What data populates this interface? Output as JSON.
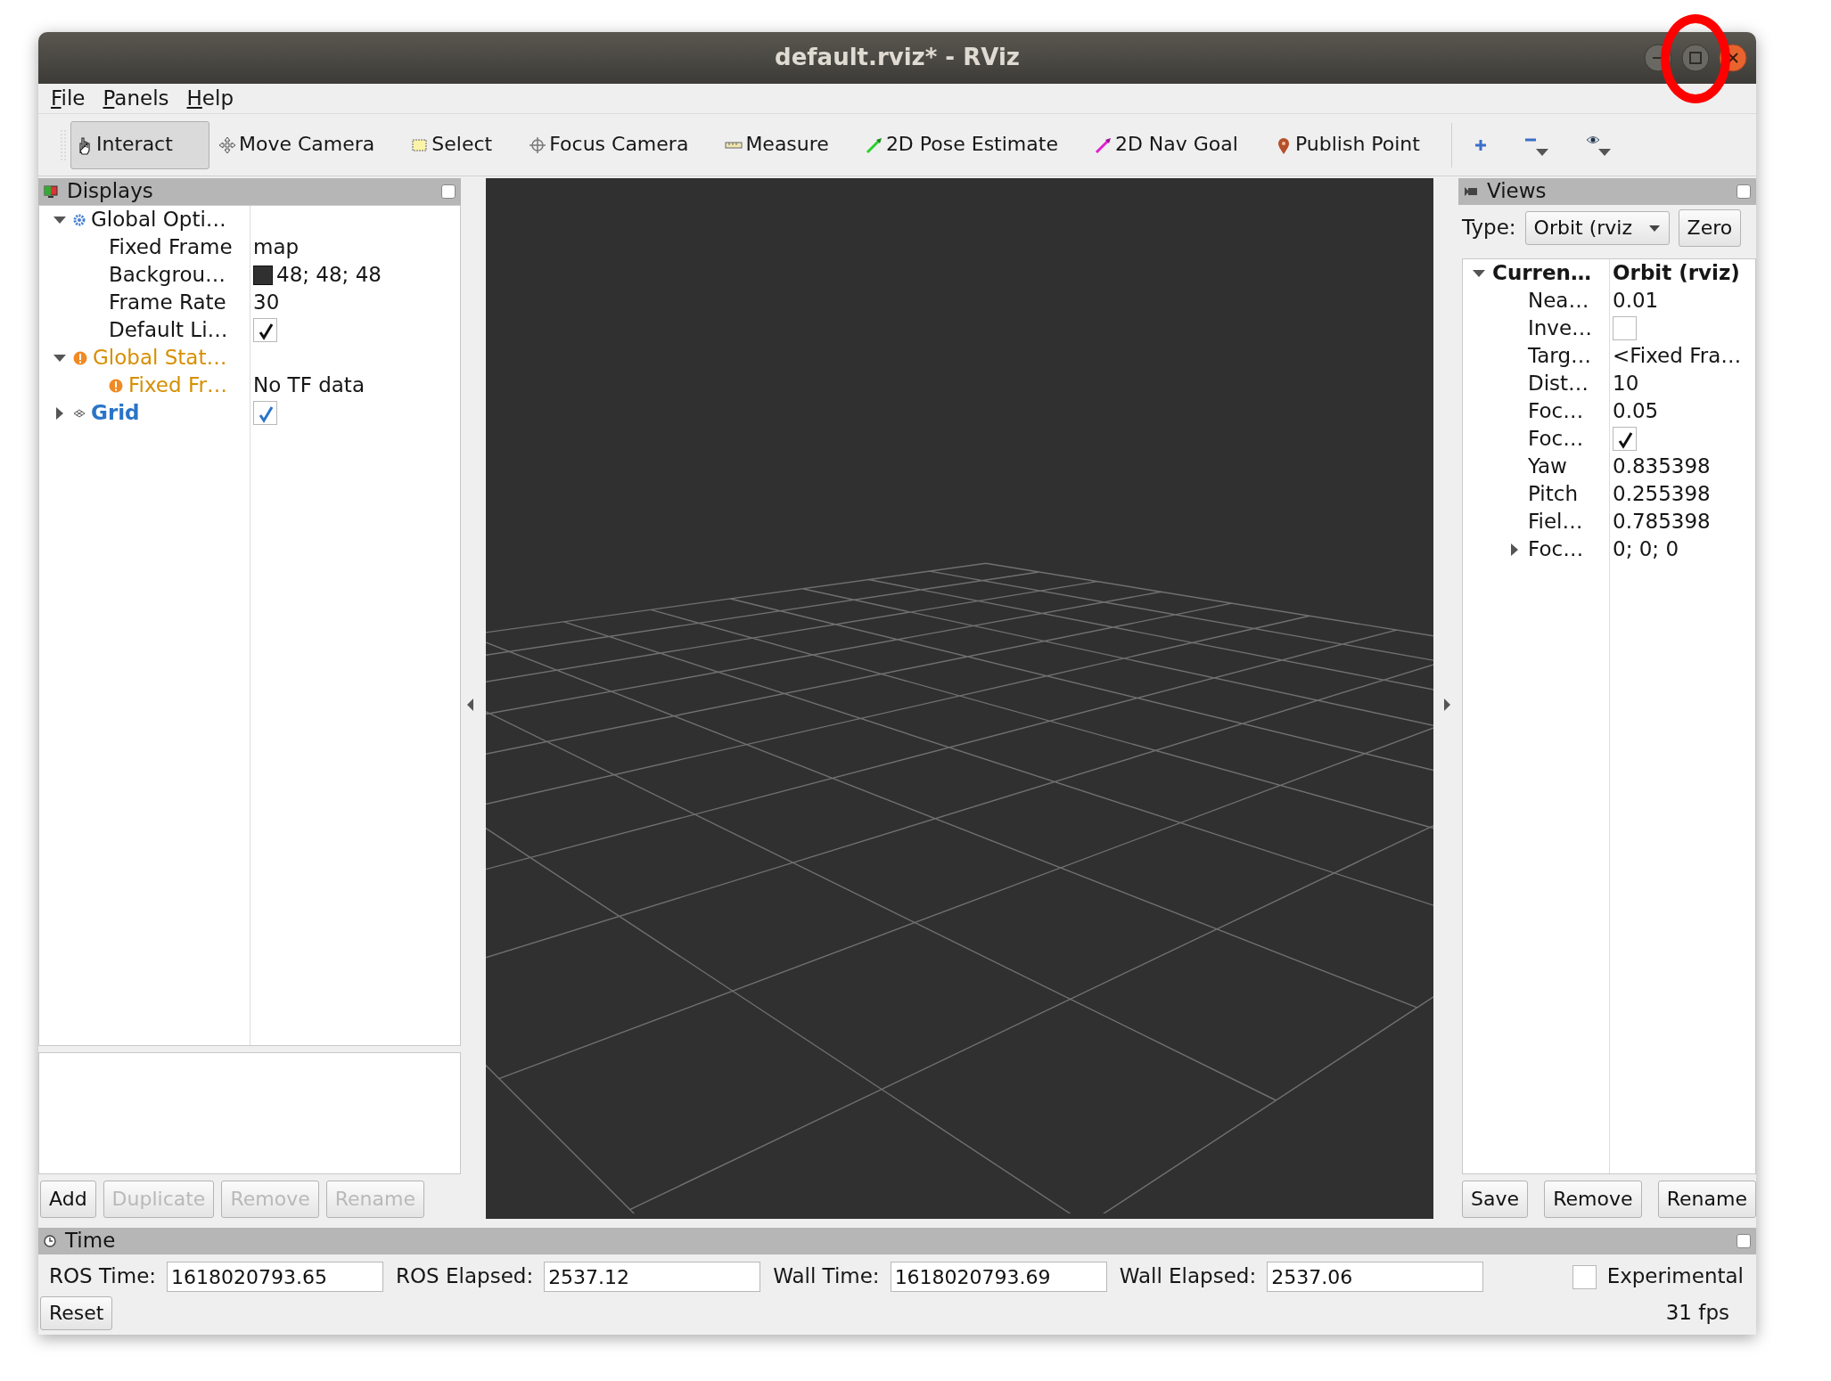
{
  "window": {
    "title": "default.rviz* - RViz"
  },
  "menu": [
    {
      "label": "File"
    },
    {
      "label": "Panels"
    },
    {
      "label": "Help"
    }
  ],
  "toolbar": {
    "tools": [
      {
        "label": "Interact",
        "selected": true
      },
      {
        "label": "Move Camera",
        "selected": false
      },
      {
        "label": "Select",
        "selected": false
      },
      {
        "label": "Focus Camera",
        "selected": false
      },
      {
        "label": "Measure",
        "selected": false
      },
      {
        "label": "2D Pose Estimate",
        "selected": false
      },
      {
        "label": "2D Nav Goal",
        "selected": false
      },
      {
        "label": "Publish Point",
        "selected": false
      }
    ]
  },
  "displays": {
    "title": "Displays",
    "tree": [
      {
        "kind": "options",
        "label": "Global Opti…",
        "expanded": true,
        "children": [
          {
            "kind": "text",
            "label": "Fixed Frame",
            "value": "map"
          },
          {
            "kind": "color",
            "label": "Backgrou…",
            "value": "48; 48; 48",
            "color": "#303030"
          },
          {
            "kind": "text",
            "label": "Frame Rate",
            "value": "30"
          },
          {
            "kind": "checkbox",
            "label": "Default Li…",
            "checked": true
          }
        ]
      },
      {
        "kind": "group",
        "label": "Global Stat…",
        "warning": true,
        "expanded": true,
        "children": [
          {
            "kind": "text",
            "label": "Fixed Fr…",
            "warning": true,
            "value": "No TF data"
          }
        ]
      },
      {
        "kind": "display",
        "label": "Grid",
        "checked": true,
        "expanded": false
      }
    ],
    "buttons": [
      {
        "label": "Add",
        "disabled": false
      },
      {
        "label": "Duplicate",
        "disabled": true
      },
      {
        "label": "Remove",
        "disabled": true
      },
      {
        "label": "Rename",
        "disabled": true
      }
    ]
  },
  "views": {
    "title": "Views",
    "type_label": "Type:",
    "type_value": "Orbit (rviz",
    "zero_button": "Zero",
    "tree": [
      {
        "kind": "view",
        "label": "Curren…",
        "value": "Orbit (rviz)",
        "expanded": true,
        "children": [
          {
            "kind": "text",
            "label": "Nea…",
            "value": "0.01"
          },
          {
            "kind": "checkbox",
            "label": "Inve…",
            "checked": false
          },
          {
            "kind": "text",
            "label": "Targ…",
            "value": "<Fixed Fra…"
          },
          {
            "kind": "text",
            "label": "Dist…",
            "value": "10"
          },
          {
            "kind": "text",
            "label": "Foc…",
            "value": "0.05"
          },
          {
            "kind": "checkbox",
            "label": "Foc…",
            "checked": true
          },
          {
            "kind": "text",
            "label": "Yaw",
            "value": "0.835398"
          },
          {
            "kind": "text",
            "label": "Pitch",
            "value": "0.255398"
          },
          {
            "kind": "text",
            "label": "Fiel…",
            "value": "0.785398"
          },
          {
            "kind": "text",
            "label": "Foc…",
            "value": "0; 0; 0",
            "expanded": false
          }
        ]
      }
    ],
    "buttons": [
      {
        "label": "Save"
      },
      {
        "label": "Remove"
      },
      {
        "label": "Rename"
      }
    ]
  },
  "time": {
    "title": "Time",
    "fields": [
      {
        "label": "ROS Time:",
        "value": "1618020793.65"
      },
      {
        "label": "ROS Elapsed:",
        "value": "2537.12"
      },
      {
        "label": "Wall Time:",
        "value": "1618020793.69"
      },
      {
        "label": "Wall Elapsed:",
        "value": "2537.06"
      }
    ],
    "experimental": {
      "label": "Experimental",
      "checked": false
    },
    "reset_button": "Reset",
    "fps": "31 fps"
  }
}
